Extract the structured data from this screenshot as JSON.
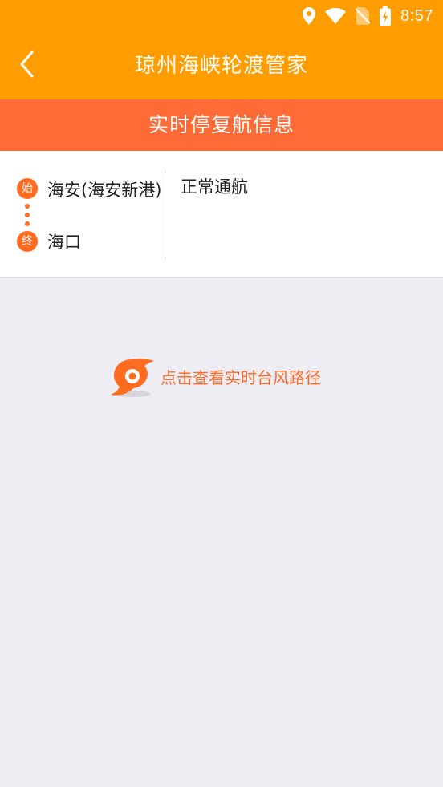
{
  "status_bar": {
    "time": "8:57",
    "icons": [
      "location-icon",
      "wifi-icon",
      "no-sim-icon",
      "battery-charging-icon"
    ]
  },
  "app_bar": {
    "back_icon": "chevron-left-icon",
    "title": "琼州海峡轮渡管家"
  },
  "section": {
    "title": "实时停复航信息"
  },
  "route": {
    "start_badge": "始",
    "start_name": "海安(海安新港)",
    "end_badge": "终",
    "end_name": "海口",
    "status": "正常通航"
  },
  "typhoon": {
    "icon": "typhoon-icon",
    "label": "点击查看实时台风路径"
  },
  "colors": {
    "app_bar": "#ff9c00",
    "section_header": "#ff6b36",
    "accent": "#ff6b1f",
    "background": "#eeedf3"
  }
}
